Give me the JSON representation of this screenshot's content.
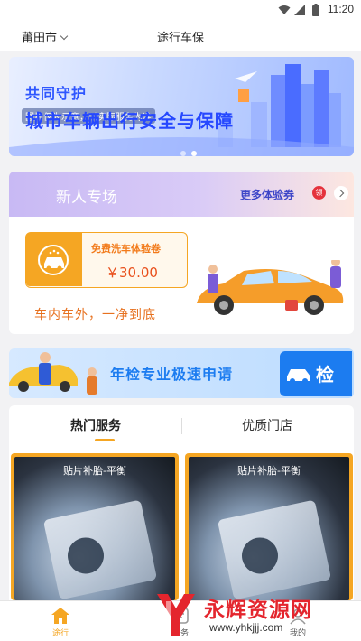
{
  "status_bar": {
    "time": "11:20"
  },
  "header": {
    "city": "莆田市",
    "title": "途行车保"
  },
  "banner": {
    "line1": "共同守护",
    "line2": "城市车辆出行安全与保障",
    "subtitle": "图片仅为示意，以实际服务为准",
    "slides": 2,
    "active_slide": 2
  },
  "new_user": {
    "title": "新人专场",
    "more_label": "更多体验券",
    "badge": "领",
    "coupon": {
      "label": "免费洗车体验卷",
      "price": "￥30.00"
    },
    "slogan": "车内车外，一净到底"
  },
  "annual_banner": {
    "text": "年检专业极速申请",
    "badge": "检"
  },
  "services": {
    "tabs": [
      "热门服务",
      "优质门店"
    ],
    "active_tab": 0,
    "cards": [
      {
        "title": "贴片补胎-平衡"
      },
      {
        "title": "贴片补胎-平衡"
      }
    ]
  },
  "tabbar": {
    "items": [
      {
        "label": "途行",
        "icon": "home-icon",
        "active": true
      },
      {
        "label": "服务",
        "icon": "service-icon",
        "active": false
      },
      {
        "label": "我的",
        "icon": "user-icon",
        "active": false
      }
    ]
  },
  "watermark": {
    "name": "永辉资源网",
    "url": "www.yhkjjj.com"
  },
  "colors": {
    "accent": "#f5a623",
    "brand_blue": "#2f57ff",
    "red": "#e4252d"
  }
}
